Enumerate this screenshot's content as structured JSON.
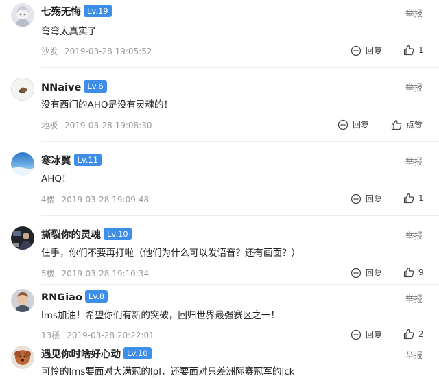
{
  "ui": {
    "report_label": "举报",
    "reply_label": "回复",
    "like_zero_label": "点赞"
  },
  "comments": [
    {
      "user": "七殇无悔",
      "level": "Lv.19",
      "text": "弯弯太真实了",
      "floor": "沙发",
      "time": "2019-03-28 19:05:52",
      "likes": "1"
    },
    {
      "user": "NNaive",
      "level": "Lv.6",
      "text": "没有西门的AHQ是没有灵魂的！",
      "floor": "地板",
      "time": "2019-03-28 19:08:30",
      "likes": ""
    },
    {
      "user": "寒冰翼",
      "level": "Lv.11",
      "text": "AHQ！",
      "floor": "4楼",
      "time": "2019-03-28 19:09:48",
      "likes": "1"
    },
    {
      "user": "撕裂你的灵魂",
      "level": "Lv.10",
      "text": "住手，你们不要再打啦（他们为什么可以发语音？还有画面？）",
      "floor": "5楼",
      "time": "2019-03-28 19:10:34",
      "likes": "9"
    },
    {
      "user": "RNGiao",
      "level": "Lv.8",
      "text": "lms加油！希望你们有新的突破，回归世界最强赛区之一！",
      "floor": "13楼",
      "time": "2019-03-28 20:22:01",
      "likes": "2"
    },
    {
      "user": "遇见你时啥好心动",
      "level": "Lv.10",
      "text": "可怜的lms要面对大满冠的lpl，还要面对只差洲际赛冠军的lck",
      "floor": "",
      "time": "",
      "likes": ""
    }
  ]
}
